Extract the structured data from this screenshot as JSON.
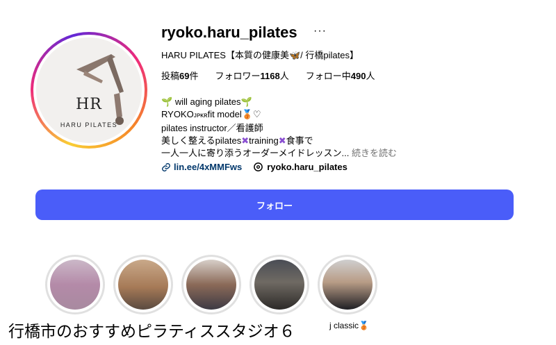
{
  "profile": {
    "username": "ryoko.haru_pilates",
    "full_name": "HARU PILATES【本質の健康美",
    "full_name_suffix": "/ 行橋pilates】",
    "avatar_monogram": "HR",
    "avatar_brand": "HARU PILATES"
  },
  "stats": {
    "posts_label": "投稿",
    "posts_count": "69",
    "posts_unit": "件",
    "followers_label": "フォロワー",
    "followers_count": "1168",
    "followers_unit": "人",
    "following_label": "フォロー中",
    "following_count": "490",
    "following_unit": "人"
  },
  "bio": {
    "line1": "will aging pilates",
    "line2_a": "RYOKO",
    "line2_b": "ᴊᴘᴋʀ",
    "line2_c": "fit model",
    "line2_d": "♡",
    "line3": "pilates instructor／看護師",
    "line4_a": "美しく整えるpilates",
    "line4_b": "training",
    "line4_c": "食事で",
    "line5": "一人一人に寄り添うオーダーメイドレッスン...",
    "more": "続きを読む"
  },
  "links": {
    "url": "lin.ee/4xMMFws",
    "threads": "ryoko.haru_pilates"
  },
  "follow_button": "フォロー",
  "highlights": {
    "overlay_caption": "行橋市のおすすめピラティススタジオ６",
    "last_label": "j classic"
  },
  "colors": {
    "follow_button": "#4a5df9",
    "link": "#00376b",
    "muted": "#737373"
  }
}
